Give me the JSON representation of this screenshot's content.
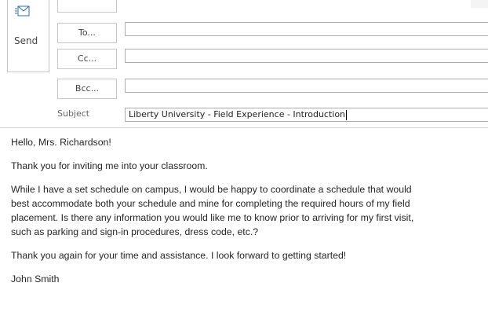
{
  "toolbar": {
    "send_label": "Send"
  },
  "address": {
    "to_label": "To...",
    "cc_label": "Cc...",
    "bcc_label": "Bcc...",
    "to_value": "",
    "cc_value": "",
    "bcc_value": ""
  },
  "subject": {
    "label": "Subject",
    "value": "Liberty University - Field Experience - Introduction"
  },
  "message": {
    "greeting": "Hello, Mrs. Richardson!",
    "paragraph1": "Thank you for inviting me into your classroom.",
    "paragraph2_line1": "While I have a set schedule on campus, I would be happy to coordinate a schedule that would",
    "paragraph2_line2": "best accommodate both your schedule and mine for completing the required hours of my field",
    "paragraph2_line3": "placement.  Is there any information you would like me to know prior to arriving for my first visit,",
    "paragraph2_line4": "such as parking and sign-in procedures, dress code, etc.?",
    "paragraph3": "Thank you again for your time and assistance.  I look forward to getting started!",
    "signature": "John Smith"
  },
  "colors": {
    "border": "#c6c6c6",
    "field_border": "#adadad",
    "text": "#262626",
    "icon_blue": "#2b6cb0"
  }
}
